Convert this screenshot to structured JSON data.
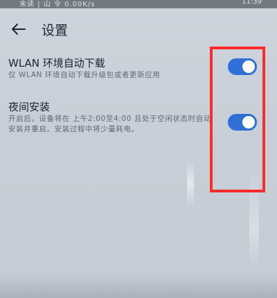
{
  "status_bar": {
    "left_text": "未读 | 山 令 0.00K/s",
    "right_text": "11:39"
  },
  "header": {
    "title": "设置",
    "back_icon": "arrow-left-icon"
  },
  "settings": [
    {
      "title": "WLAN 环境自动下载",
      "description": "仅 WLAN 环境自动下载升级包或者更新应用",
      "enabled": true
    },
    {
      "title": "夜间安装",
      "description": "开启后，设备将在 上午2:00至4:00 且处于空闲状态时自动安装并重启。安装过程中将少量耗电。",
      "enabled": true
    }
  ],
  "colors": {
    "toggle_on": "#2f6fd8",
    "highlight": "#ff2a2a",
    "background": "#c8cfd8"
  }
}
